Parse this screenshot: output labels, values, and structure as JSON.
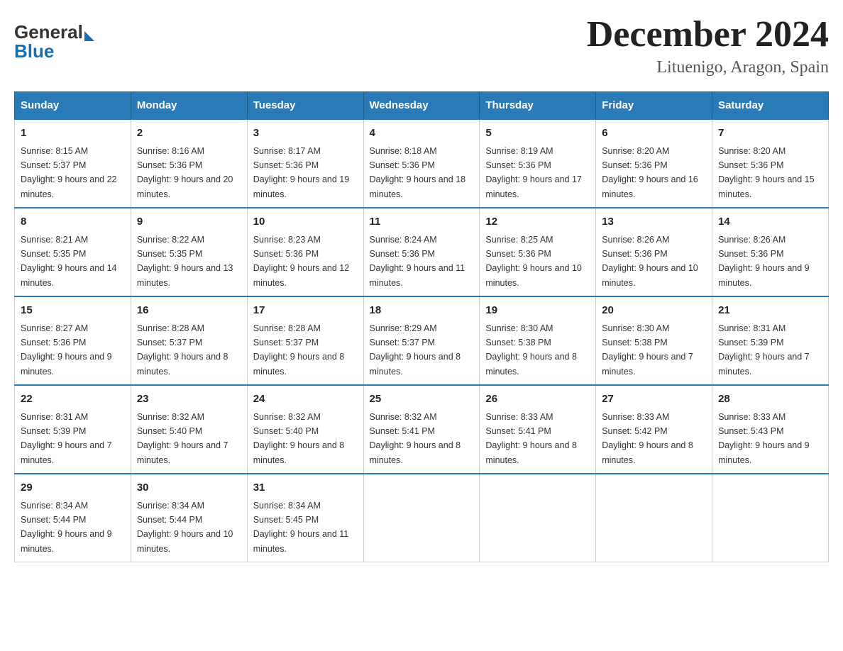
{
  "logo": {
    "text_general": "General",
    "text_blue": "Blue"
  },
  "header": {
    "month_title": "December 2024",
    "location": "Lituenigo, Aragon, Spain"
  },
  "weekdays": [
    "Sunday",
    "Monday",
    "Tuesday",
    "Wednesday",
    "Thursday",
    "Friday",
    "Saturday"
  ],
  "weeks": [
    [
      {
        "day": "1",
        "sunrise": "8:15 AM",
        "sunset": "5:37 PM",
        "daylight": "9 hours and 22 minutes."
      },
      {
        "day": "2",
        "sunrise": "8:16 AM",
        "sunset": "5:36 PM",
        "daylight": "9 hours and 20 minutes."
      },
      {
        "day": "3",
        "sunrise": "8:17 AM",
        "sunset": "5:36 PM",
        "daylight": "9 hours and 19 minutes."
      },
      {
        "day": "4",
        "sunrise": "8:18 AM",
        "sunset": "5:36 PM",
        "daylight": "9 hours and 18 minutes."
      },
      {
        "day": "5",
        "sunrise": "8:19 AM",
        "sunset": "5:36 PM",
        "daylight": "9 hours and 17 minutes."
      },
      {
        "day": "6",
        "sunrise": "8:20 AM",
        "sunset": "5:36 PM",
        "daylight": "9 hours and 16 minutes."
      },
      {
        "day": "7",
        "sunrise": "8:20 AM",
        "sunset": "5:36 PM",
        "daylight": "9 hours and 15 minutes."
      }
    ],
    [
      {
        "day": "8",
        "sunrise": "8:21 AM",
        "sunset": "5:35 PM",
        "daylight": "9 hours and 14 minutes."
      },
      {
        "day": "9",
        "sunrise": "8:22 AM",
        "sunset": "5:35 PM",
        "daylight": "9 hours and 13 minutes."
      },
      {
        "day": "10",
        "sunrise": "8:23 AM",
        "sunset": "5:36 PM",
        "daylight": "9 hours and 12 minutes."
      },
      {
        "day": "11",
        "sunrise": "8:24 AM",
        "sunset": "5:36 PM",
        "daylight": "9 hours and 11 minutes."
      },
      {
        "day": "12",
        "sunrise": "8:25 AM",
        "sunset": "5:36 PM",
        "daylight": "9 hours and 10 minutes."
      },
      {
        "day": "13",
        "sunrise": "8:26 AM",
        "sunset": "5:36 PM",
        "daylight": "9 hours and 10 minutes."
      },
      {
        "day": "14",
        "sunrise": "8:26 AM",
        "sunset": "5:36 PM",
        "daylight": "9 hours and 9 minutes."
      }
    ],
    [
      {
        "day": "15",
        "sunrise": "8:27 AM",
        "sunset": "5:36 PM",
        "daylight": "9 hours and 9 minutes."
      },
      {
        "day": "16",
        "sunrise": "8:28 AM",
        "sunset": "5:37 PM",
        "daylight": "9 hours and 8 minutes."
      },
      {
        "day": "17",
        "sunrise": "8:28 AM",
        "sunset": "5:37 PM",
        "daylight": "9 hours and 8 minutes."
      },
      {
        "day": "18",
        "sunrise": "8:29 AM",
        "sunset": "5:37 PM",
        "daylight": "9 hours and 8 minutes."
      },
      {
        "day": "19",
        "sunrise": "8:30 AM",
        "sunset": "5:38 PM",
        "daylight": "9 hours and 8 minutes."
      },
      {
        "day": "20",
        "sunrise": "8:30 AM",
        "sunset": "5:38 PM",
        "daylight": "9 hours and 7 minutes."
      },
      {
        "day": "21",
        "sunrise": "8:31 AM",
        "sunset": "5:39 PM",
        "daylight": "9 hours and 7 minutes."
      }
    ],
    [
      {
        "day": "22",
        "sunrise": "8:31 AM",
        "sunset": "5:39 PM",
        "daylight": "9 hours and 7 minutes."
      },
      {
        "day": "23",
        "sunrise": "8:32 AM",
        "sunset": "5:40 PM",
        "daylight": "9 hours and 7 minutes."
      },
      {
        "day": "24",
        "sunrise": "8:32 AM",
        "sunset": "5:40 PM",
        "daylight": "9 hours and 8 minutes."
      },
      {
        "day": "25",
        "sunrise": "8:32 AM",
        "sunset": "5:41 PM",
        "daylight": "9 hours and 8 minutes."
      },
      {
        "day": "26",
        "sunrise": "8:33 AM",
        "sunset": "5:41 PM",
        "daylight": "9 hours and 8 minutes."
      },
      {
        "day": "27",
        "sunrise": "8:33 AM",
        "sunset": "5:42 PM",
        "daylight": "9 hours and 8 minutes."
      },
      {
        "day": "28",
        "sunrise": "8:33 AM",
        "sunset": "5:43 PM",
        "daylight": "9 hours and 9 minutes."
      }
    ],
    [
      {
        "day": "29",
        "sunrise": "8:34 AM",
        "sunset": "5:44 PM",
        "daylight": "9 hours and 9 minutes."
      },
      {
        "day": "30",
        "sunrise": "8:34 AM",
        "sunset": "5:44 PM",
        "daylight": "9 hours and 10 minutes."
      },
      {
        "day": "31",
        "sunrise": "8:34 AM",
        "sunset": "5:45 PM",
        "daylight": "9 hours and 11 minutes."
      },
      null,
      null,
      null,
      null
    ]
  ]
}
